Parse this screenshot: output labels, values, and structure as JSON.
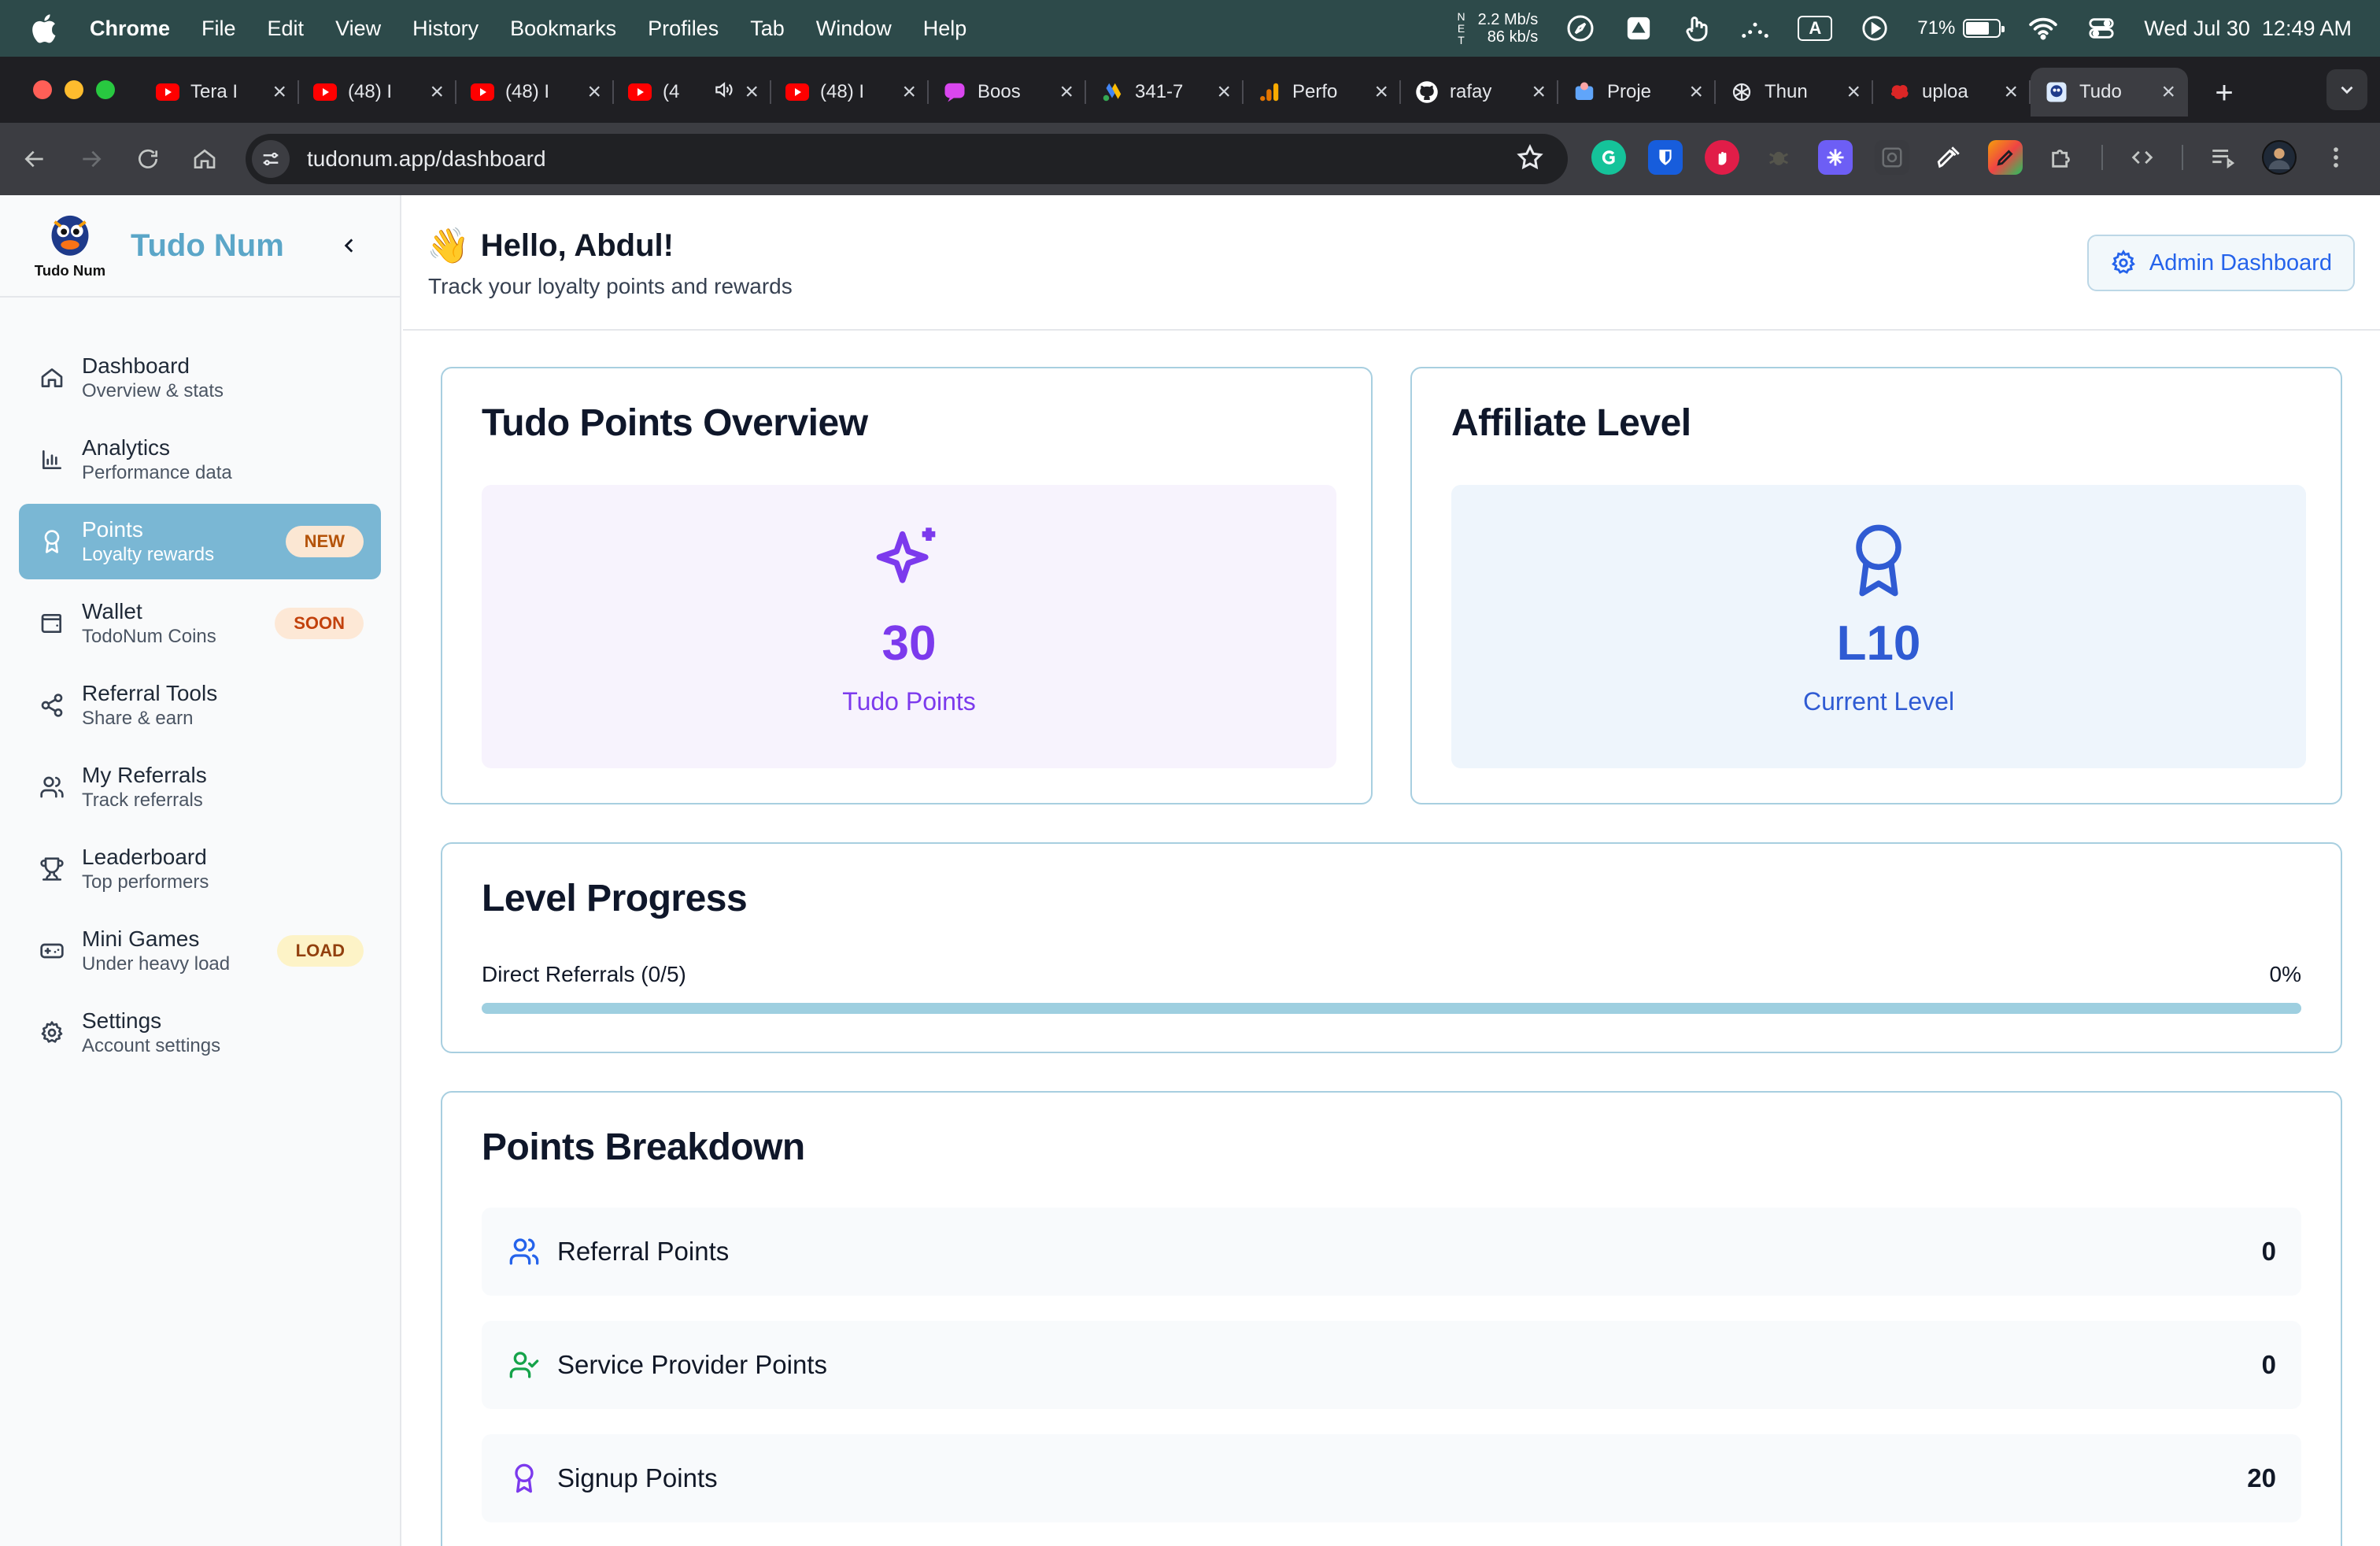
{
  "menubar": {
    "app": "Chrome",
    "items": [
      "File",
      "Edit",
      "View",
      "History",
      "Bookmarks",
      "Profiles",
      "Tab",
      "Window",
      "Help"
    ],
    "net_letters": "N\nE\nT",
    "net_up": "2.2 Mb/s",
    "net_down": "86 kb/s",
    "input_source": "A",
    "battery_percent": "71%",
    "battery_level": 0.71,
    "clock": "Wed Jul 30  12:49 AM"
  },
  "tabs": [
    {
      "title": "Tera I",
      "icon": "youtube-icon",
      "color": "#ff0000"
    },
    {
      "title": "(48) I",
      "icon": "youtube-icon",
      "color": "#ff0000"
    },
    {
      "title": "(48) I",
      "icon": "youtube-icon",
      "color": "#ff0000"
    },
    {
      "title": "(4",
      "icon": "youtube-icon",
      "color": "#ff0000",
      "audio": true
    },
    {
      "title": "(48) I",
      "icon": "youtube-icon",
      "color": "#ff0000"
    },
    {
      "title": "Boos",
      "icon": "chat-bubble-icon",
      "color": "#d946ef"
    },
    {
      "title": "341-7",
      "icon": "google-ads-icon",
      "color": "#4285f4"
    },
    {
      "title": "Perfo",
      "icon": "analytics-icon",
      "color": "#f9ab00"
    },
    {
      "title": "rafay",
      "icon": "github-icon",
      "color": "#ffffff"
    },
    {
      "title": "Proje",
      "icon": "project-icon",
      "color": "#60a5fa"
    },
    {
      "title": "Thun",
      "icon": "openai-icon",
      "color": "#e5e7eb"
    },
    {
      "title": "uploa",
      "icon": "upload-icon",
      "color": "#dc2626"
    },
    {
      "title": "Tudo",
      "icon": "tudonum-icon",
      "color": "#5ba6c8",
      "active": true
    }
  ],
  "toolbar": {
    "url": "tudonum.app/dashboard"
  },
  "sidebar": {
    "brand": "Tudo Num",
    "logo_text": "Tudo Num",
    "items": [
      {
        "label": "Dashboard",
        "sub": "Overview & stats",
        "icon": "home-icon"
      },
      {
        "label": "Analytics",
        "sub": "Performance data",
        "icon": "bar-chart-icon"
      },
      {
        "label": "Points",
        "sub": "Loyalty rewards",
        "icon": "award-icon",
        "badge": "NEW",
        "active": true
      },
      {
        "label": "Wallet",
        "sub": "TodoNum Coins",
        "icon": "wallet-icon",
        "badge": "SOON"
      },
      {
        "label": "Referral Tools",
        "sub": "Share & earn",
        "icon": "share-icon"
      },
      {
        "label": "My Referrals",
        "sub": "Track referrals",
        "icon": "users-icon"
      },
      {
        "label": "Leaderboard",
        "sub": "Top performers",
        "icon": "trophy-icon"
      },
      {
        "label": "Mini Games",
        "sub": "Under heavy load",
        "icon": "gamepad-icon",
        "badge": "LOAD"
      },
      {
        "label": "Settings",
        "sub": "Account settings",
        "icon": "gear-icon"
      }
    ]
  },
  "header": {
    "wave": "👋",
    "greeting": "Hello, Abdul!",
    "tagline": "Track your loyalty points and rewards",
    "admin_button": "Admin Dashboard"
  },
  "points_overview": {
    "title": "Tudo Points Overview",
    "value": "30",
    "caption": "Tudo Points",
    "accent": "#7c3aed",
    "panel_bg": "#f7f3fd"
  },
  "affiliate": {
    "title": "Affiliate Level",
    "value": "L10",
    "caption": "Current Level",
    "accent": "#2f5bd3",
    "panel_bg": "#eef5fc"
  },
  "level_progress": {
    "title": "Level Progress",
    "label": "Direct Referrals (0/5)",
    "percent_text": "0%",
    "percent": 0
  },
  "breakdown": {
    "title": "Points Breakdown",
    "rows": [
      {
        "label": "Referral Points",
        "value": "0",
        "icon": "users-icon",
        "color": "#2563eb"
      },
      {
        "label": "Service Provider Points",
        "value": "0",
        "icon": "user-check-icon",
        "color": "#16a34a"
      },
      {
        "label": "Signup Points",
        "value": "20",
        "icon": "award-icon",
        "color": "#7c3aed"
      }
    ]
  }
}
